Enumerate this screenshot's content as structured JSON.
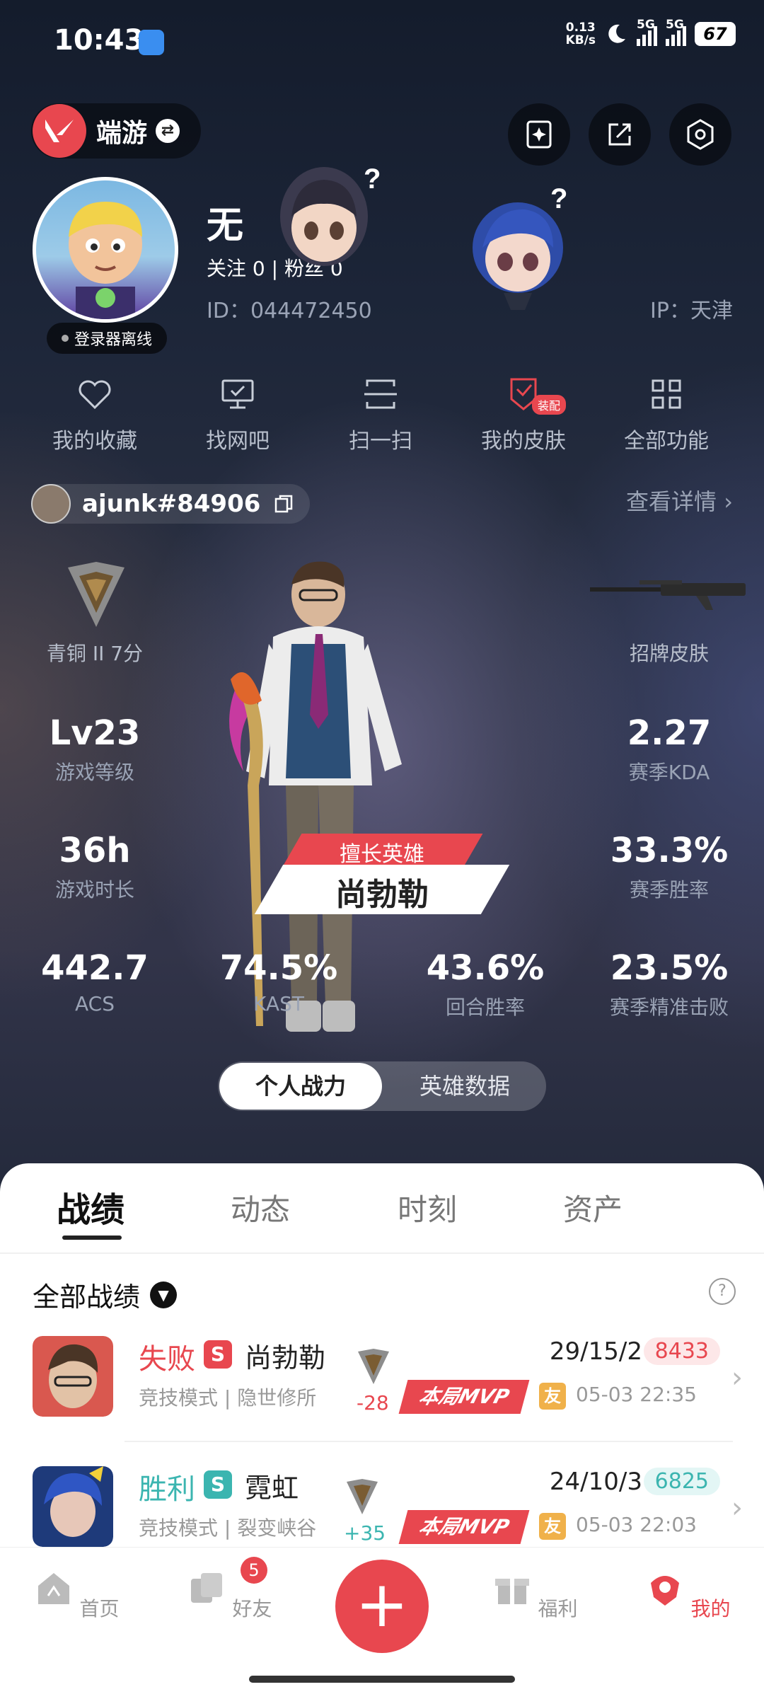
{
  "status_bar": {
    "time": "10:43",
    "net_speed": "0.13",
    "net_unit": "KB/s",
    "sig1": "5G",
    "sig2": "5G",
    "battery": "67"
  },
  "header": {
    "game_switch_label": "端游",
    "icons": [
      "sparkle-card-icon",
      "share-icon",
      "settings-icon"
    ]
  },
  "profile": {
    "name": "无",
    "follow": "关注 0  |  粉丝 0",
    "id": "ID：044472450",
    "ip": "IP：天津",
    "offline": "登录器离线"
  },
  "menu": [
    {
      "label": "我的收藏",
      "icon": "heart-icon"
    },
    {
      "label": "找网吧",
      "icon": "monitor-icon"
    },
    {
      "label": "扫一扫",
      "icon": "scan-icon"
    },
    {
      "label": "我的皮肤",
      "icon": "skin-icon",
      "badge": "装配"
    },
    {
      "label": "全部功能",
      "icon": "grid-icon"
    }
  ],
  "player": {
    "riot_id": "ajunk#84906",
    "view_detail": "查看详情"
  },
  "stats": {
    "rank": "青铜 II 7分",
    "signature_skin": "招牌皮肤",
    "level_value": "Lv23",
    "level_label": "游戏等级",
    "kda_value": "2.27",
    "kda_label": "赛季KDA",
    "hours_value": "36h",
    "hours_label": "游戏时长",
    "winrate_value": "33.3%",
    "winrate_label": "赛季胜率",
    "acs_value": "442.7",
    "acs_label": "ACS",
    "kast_value": "74.5%",
    "kast_label": "KAST",
    "round_value": "43.6%",
    "round_label": "回合胜率",
    "headshot_value": "23.5%",
    "headshot_label": "赛季精准击败",
    "fav_label": "擅长英雄",
    "fav_hero": "尚勃勒"
  },
  "toggle": {
    "on": "个人战力",
    "off": "英雄数据"
  },
  "tabs": [
    "战绩",
    "动态",
    "时刻",
    "资产"
  ],
  "records": {
    "title": "全部战绩",
    "help": "?",
    "items": [
      {
        "result": "失败",
        "s": "S",
        "hero": "尚勃勒",
        "mode": "竞技模式 | 隐世修所",
        "delta": "-28",
        "kda": "29/15/2",
        "score": "8433",
        "mvp": "本局MVP",
        "you": "友",
        "time": "05-03 22:35",
        "result_color": "#e8474f",
        "score_bg": "#fde7e8",
        "score_color": "#e8474f"
      },
      {
        "result": "胜利",
        "s": "S",
        "hero": "霓虹",
        "mode": "竞技模式 | 裂变峡谷",
        "delta": "+35",
        "kda": "24/10/3",
        "score": "6825",
        "mvp": "本局MVP",
        "you": "友",
        "time": "05-03 22:03",
        "result_color": "#3bb5b0",
        "score_bg": "#e3f6f5",
        "score_color": "#3bb5b0"
      }
    ]
  },
  "bottom_nav": {
    "home": "首页",
    "friends": "好友",
    "friends_badge": "5",
    "plus": "+",
    "welfare": "福利",
    "me": "我的"
  },
  "colors": {
    "accent": "#e8474f",
    "win": "#3bb5b0",
    "loss": "#e8474f"
  }
}
